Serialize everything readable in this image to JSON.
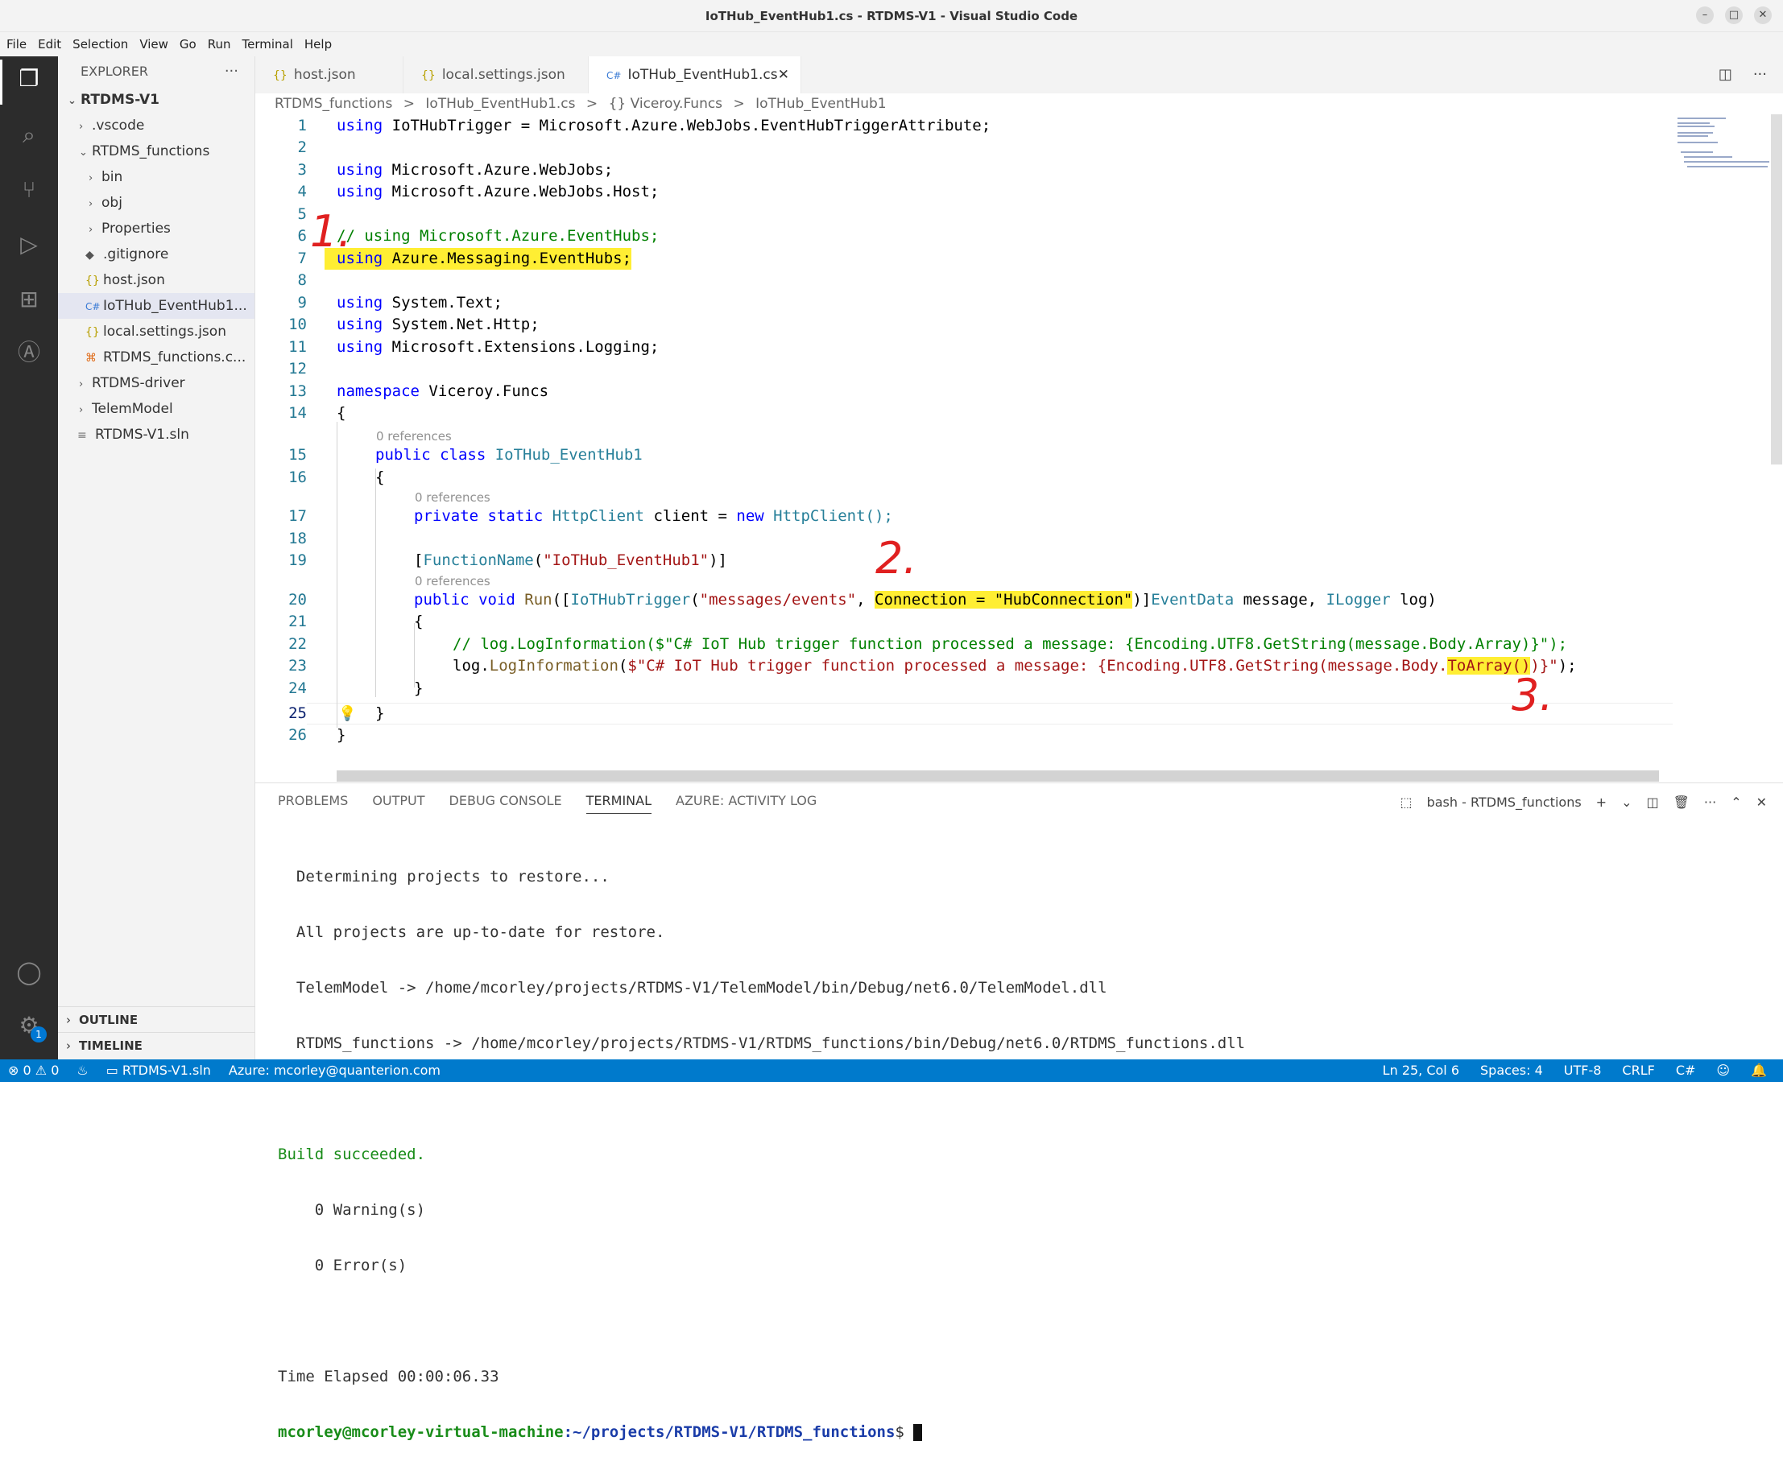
{
  "window": {
    "title": "IoTHub_EventHub1.cs - RTDMS-V1 - Visual Studio Code"
  },
  "menu": [
    "File",
    "Edit",
    "Selection",
    "View",
    "Go",
    "Run",
    "Terminal",
    "Help"
  ],
  "activity": {
    "settings_badge": "1"
  },
  "explorer": {
    "header": "EXPLORER",
    "root": "RTDMS-V1",
    "items": [
      {
        "label": ".vscode",
        "chev": "›",
        "icon": ""
      },
      {
        "label": "RTDMS_functions",
        "chev": "⌄",
        "icon": ""
      },
      {
        "label": "bin",
        "chev": "›",
        "icon": ""
      },
      {
        "label": "obj",
        "chev": "›",
        "icon": ""
      },
      {
        "label": "Properties",
        "chev": "›",
        "icon": ""
      },
      {
        "label": ".gitignore",
        "chev": "",
        "icon": "◆"
      },
      {
        "label": "host.json",
        "chev": "",
        "icon": "{}"
      },
      {
        "label": "IoTHub_EventHub1...",
        "chev": "",
        "icon": "C#"
      },
      {
        "label": "local.settings.json",
        "chev": "",
        "icon": "{}"
      },
      {
        "label": "RTDMS_functions.c...",
        "chev": "",
        "icon": "⌘"
      },
      {
        "label": "RTDMS-driver",
        "chev": "›",
        "icon": ""
      },
      {
        "label": "TelemModel",
        "chev": "›",
        "icon": ""
      },
      {
        "label": "RTDMS-V1.sln",
        "chev": "",
        "icon": "≡"
      }
    ],
    "outline": "OUTLINE",
    "timeline": "TIMELINE"
  },
  "tabs": [
    {
      "label": "host.json",
      "icon": "{}"
    },
    {
      "label": "local.settings.json",
      "icon": "{}"
    },
    {
      "label": "IoTHub_EventHub1.cs",
      "icon": "C#"
    }
  ],
  "breadcrumb": [
    "RTDMS_functions",
    ">",
    "IoTHub_EventHub1.cs",
    ">",
    "{} Viceroy.Funcs",
    ">",
    "IoTHub_EventHub1"
  ],
  "editor": {
    "line_numbers": [
      "1",
      "2",
      "3",
      "4",
      "5",
      "6",
      "7",
      "8",
      "9",
      "10",
      "11",
      "12",
      "13",
      "14",
      "15",
      "16",
      "17",
      "18",
      "19",
      "20",
      "21",
      "22",
      "23",
      "24",
      "25",
      "26"
    ],
    "codelens": "0 references",
    "l1a": "using",
    "l1b": " IoTHubTrigger = Microsoft.Azure.WebJobs.EventHubTriggerAttribute;",
    "l3a": "using",
    "l3b": " Microsoft.Azure.WebJobs;",
    "l4a": "using",
    "l4b": " Microsoft.Azure.WebJobs.Host;",
    "l6": "// using Microsoft.Azure.EventHubs;",
    "l7a": "using",
    "l7b": " Azure.Messaging.EventHubs;",
    "l9a": "using",
    "l9b": " System.Text;",
    "l10a": "using",
    "l10b": " System.Net.Http;",
    "l11a": "using",
    "l11b": " Microsoft.Extensions.Logging;",
    "l13a": "namespace",
    "l13b": " Viceroy.Funcs",
    "l14": "{",
    "l15a": "public class",
    "l15b": " IoTHub_EventHub1",
    "l16": "{",
    "l17a": "private static",
    "l17b": " HttpClient",
    "l17c": " client = ",
    "l17d": "new",
    "l17e": " HttpClient();",
    "l19a": "[",
    "l19b": "FunctionName",
    "l19c": "(",
    "l19d": "\"IoTHub_EventHub1\"",
    "l19e": ")]",
    "l20a": "public void",
    "l20b": " Run",
    "l20c": "([",
    "l20d": "IoTHubTrigger",
    "l20e": "(",
    "l20f": "\"messages/events\"",
    "l20g": ", ",
    "l20h": "Connection = \"HubConnection\"",
    "l20i": ")]",
    "l20j": "EventData",
    "l20k": " message, ",
    "l20l": "ILogger",
    "l20m": " log)",
    "l21": "{",
    "l22": "// log.LogInformation($\"C# IoT Hub trigger function processed a message: {Encoding.UTF8.GetString(message.Body.Array)}\");",
    "l23a": "log.",
    "l23b": "LogInformation",
    "l23c": "(",
    "l23d": "$\"C# IoT Hub trigger function processed a message: ",
    "l23e": "{Encoding.UTF8.GetString(message.Body.",
    "l23f": "ToArray()",
    "l23g": ")}\"",
    "l23h": ");",
    "l24": "}",
    "l25": "}",
    "l26": "}"
  },
  "annotations": {
    "a1": "1.",
    "a2": "2.",
    "a3": "3."
  },
  "panel": {
    "tabs": [
      "PROBLEMS",
      "OUTPUT",
      "DEBUG CONSOLE",
      "TERMINAL",
      "AZURE: ACTIVITY LOG"
    ],
    "active_tab": "TERMINAL",
    "shell": "bash - RTDMS_functions",
    "terminal": [
      "  Determining projects to restore...",
      "  All projects are up-to-date for restore.",
      "  TelemModel -> /home/mcorley/projects/RTDMS-V1/TelemModel/bin/Debug/net6.0/TelemModel.dll",
      "  RTDMS_functions -> /home/mcorley/projects/RTDMS-V1/RTDMS_functions/bin/Debug/net6.0/RTDMS_functions.dll",
      "",
      "Build succeeded.",
      "    0 Warning(s)",
      "    0 Error(s)",
      "",
      "Time Elapsed 00:00:06.33"
    ],
    "prompt_user": "mcorley@mcorley-virtual-machine",
    "prompt_path": ":~/projects/RTDMS-V1/RTDMS_functions",
    "prompt_sign": "$ "
  },
  "status": {
    "errors": "⊗ 0 ⚠ 0",
    "sln": "RTDMS-V1.sln",
    "azure": "Azure: mcorley@quanterion.com",
    "position": "Ln 25, Col 6",
    "spaces": "Spaces: 4",
    "encoding": "UTF-8",
    "eol": "CRLF",
    "lang": "C#"
  },
  "colors": {
    "accent": "#007acc",
    "highlight": "#ffee33",
    "annotation": "#e02020"
  }
}
